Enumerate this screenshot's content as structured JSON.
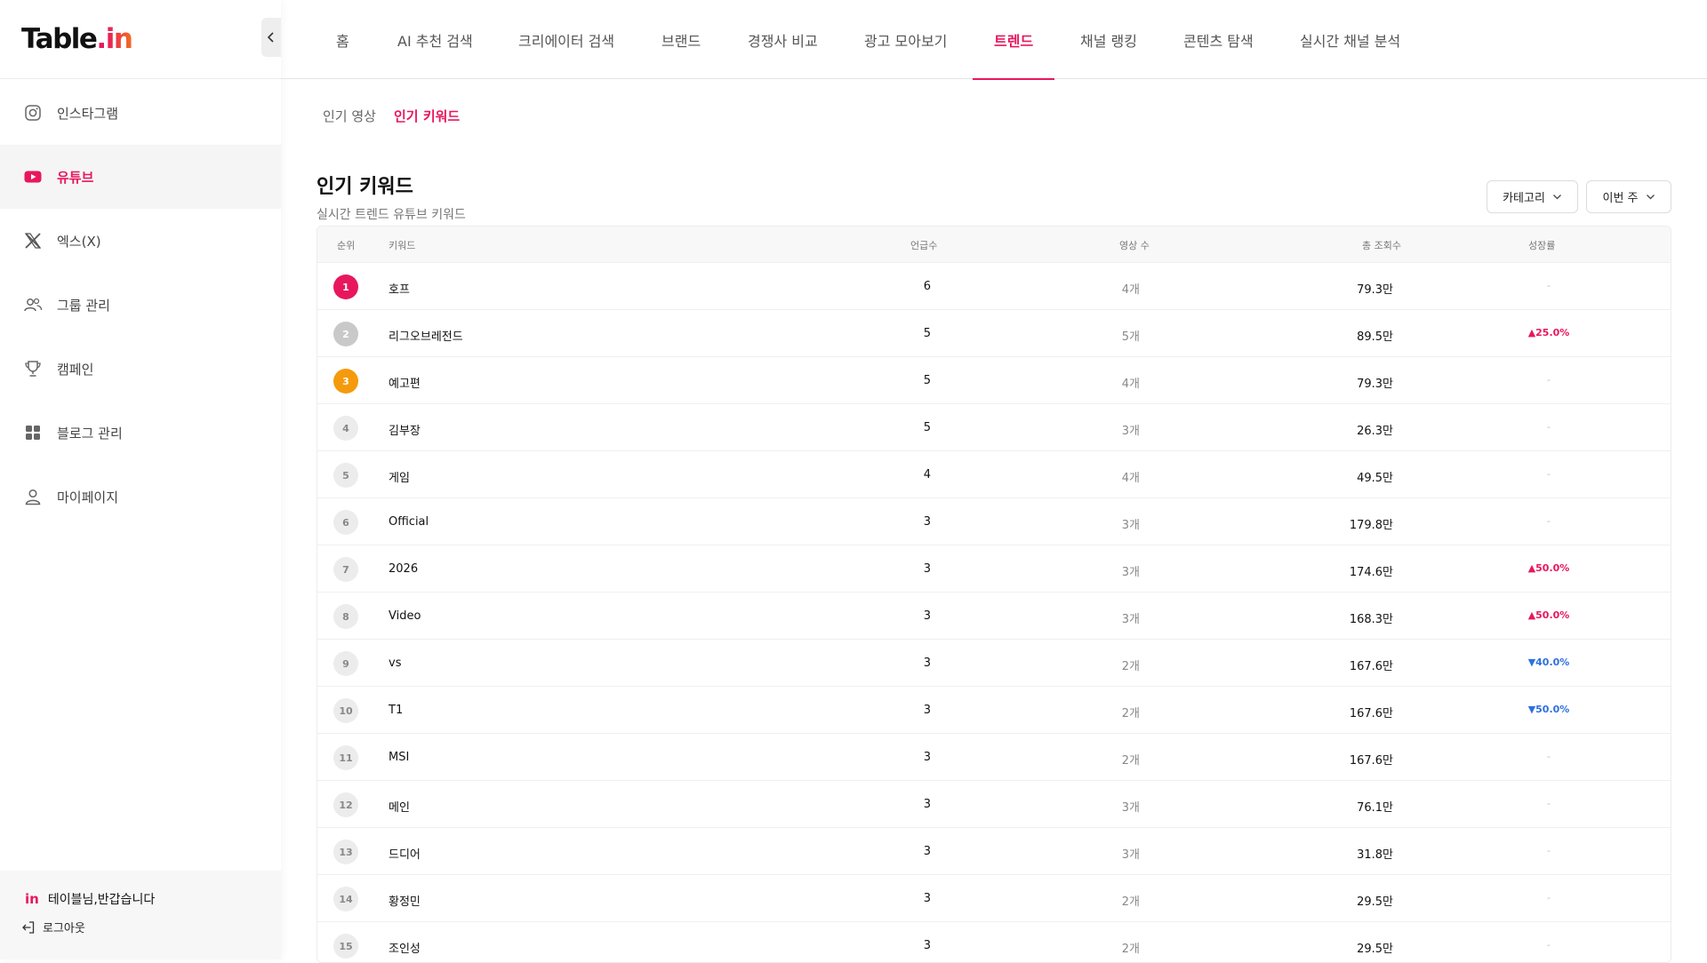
{
  "brand": {
    "logo_main": "Table",
    "logo_dot": ".",
    "logo_in": "in",
    "mini_logo": "in"
  },
  "sidebar": {
    "items": [
      {
        "label": "인스타그램",
        "icon": "instagram-icon",
        "active": false
      },
      {
        "label": "유튜브",
        "icon": "youtube-icon",
        "active": true
      },
      {
        "label": "엑스(X)",
        "icon": "x-icon",
        "active": false
      },
      {
        "label": "그룹 관리",
        "icon": "group-icon",
        "active": false
      },
      {
        "label": "캠페인",
        "icon": "trophy-icon",
        "active": false
      },
      {
        "label": "블로그 관리",
        "icon": "grid-icon",
        "active": false
      },
      {
        "label": "마이페이지",
        "icon": "user-icon",
        "active": false
      }
    ],
    "greeting": "테이블님,반갑습니다",
    "logout": "로그아웃"
  },
  "topnav": {
    "items": [
      {
        "label": "홈"
      },
      {
        "label": "AI 추천 검색"
      },
      {
        "label": "크리에이터 검색"
      },
      {
        "label": "브랜드"
      },
      {
        "label": "경쟁사 비교"
      },
      {
        "label": "광고 모아보기"
      },
      {
        "label": "트렌드",
        "active": true
      },
      {
        "label": "채널 랭킹"
      },
      {
        "label": "콘텐츠 탐색"
      },
      {
        "label": "실시간 채널 분석"
      }
    ]
  },
  "subtabs": [
    {
      "label": "인기 영상",
      "active": false
    },
    {
      "label": "인기 키워드",
      "active": true
    }
  ],
  "main": {
    "title": "인기 키워드",
    "subtitle": "실시간 트렌드 유튜브 키워드",
    "filters": {
      "category": "카테고리",
      "period": "이번 주"
    }
  },
  "table": {
    "headers": {
      "rank": "순위",
      "keyword": "키워드",
      "mentions": "언급수",
      "videos": "영상 수",
      "views": "총 조회수",
      "growth": "성장률"
    },
    "rows": [
      {
        "rank": "1",
        "keyword": "호프",
        "mentions": "6",
        "videos": "4개",
        "views": "79.3만",
        "growth": "-",
        "trend": "none"
      },
      {
        "rank": "2",
        "keyword": "리그오브레전드",
        "mentions": "5",
        "videos": "5개",
        "views": "89.5만",
        "growth": "▲25.0%",
        "trend": "up"
      },
      {
        "rank": "3",
        "keyword": "예고편",
        "mentions": "5",
        "videos": "4개",
        "views": "79.3만",
        "growth": "-",
        "trend": "none"
      },
      {
        "rank": "4",
        "keyword": "김부장",
        "mentions": "5",
        "videos": "3개",
        "views": "26.3만",
        "growth": "-",
        "trend": "none"
      },
      {
        "rank": "5",
        "keyword": "게임",
        "mentions": "4",
        "videos": "4개",
        "views": "49.5만",
        "growth": "-",
        "trend": "none"
      },
      {
        "rank": "6",
        "keyword": "Official",
        "mentions": "3",
        "videos": "3개",
        "views": "179.8만",
        "growth": "-",
        "trend": "none"
      },
      {
        "rank": "7",
        "keyword": "2026",
        "mentions": "3",
        "videos": "3개",
        "views": "174.6만",
        "growth": "▲50.0%",
        "trend": "up"
      },
      {
        "rank": "8",
        "keyword": "Video",
        "mentions": "3",
        "videos": "3개",
        "views": "168.3만",
        "growth": "▲50.0%",
        "trend": "up"
      },
      {
        "rank": "9",
        "keyword": "vs",
        "mentions": "3",
        "videos": "2개",
        "views": "167.6만",
        "growth": "▼40.0%",
        "trend": "down"
      },
      {
        "rank": "10",
        "keyword": "T1",
        "mentions": "3",
        "videos": "2개",
        "views": "167.6만",
        "growth": "▼50.0%",
        "trend": "down"
      },
      {
        "rank": "11",
        "keyword": "MSI",
        "mentions": "3",
        "videos": "2개",
        "views": "167.6만",
        "growth": "-",
        "trend": "none"
      },
      {
        "rank": "12",
        "keyword": "메인",
        "mentions": "3",
        "videos": "3개",
        "views": "76.1만",
        "growth": "-",
        "trend": "none"
      },
      {
        "rank": "13",
        "keyword": "드디어",
        "mentions": "3",
        "videos": "3개",
        "views": "31.8만",
        "growth": "-",
        "trend": "none"
      },
      {
        "rank": "14",
        "keyword": "황정민",
        "mentions": "3",
        "videos": "2개",
        "views": "29.5만",
        "growth": "-",
        "trend": "none"
      },
      {
        "rank": "15",
        "keyword": "조인성",
        "mentions": "3",
        "videos": "2개",
        "views": "29.5만",
        "growth": "-",
        "trend": "none"
      }
    ]
  },
  "colors": {
    "accent": "#e8175d",
    "rank_gold": "#f59a0c",
    "rank_silver": "#c9c9c9",
    "down": "#2f6fe0"
  }
}
